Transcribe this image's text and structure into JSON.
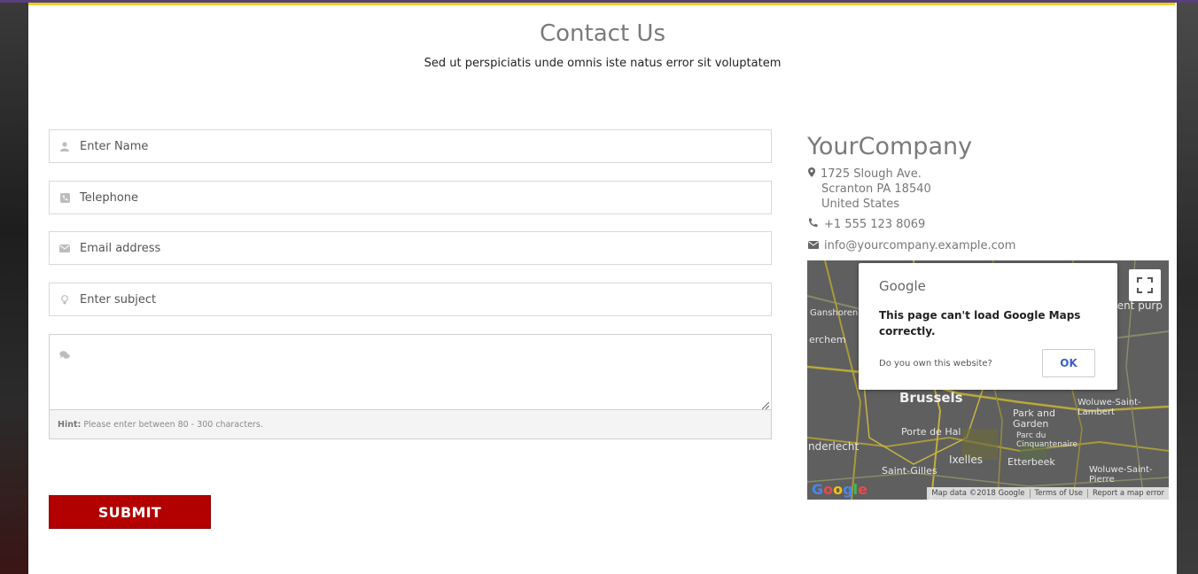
{
  "header": {
    "title": "Contact Us",
    "subtitle": "Sed ut perspiciatis unde omnis iste natus error sit voluptatem"
  },
  "form": {
    "name_placeholder": "Enter Name",
    "telephone_placeholder": "Telephone",
    "email_placeholder": "Email address",
    "subject_placeholder": "Enter subject",
    "message_placeholder": "",
    "hint_label": "Hint:",
    "hint_text": "Please enter between 80 - 300 characters.",
    "submit_label": "SUBMIT"
  },
  "company": {
    "name": "YourCompany",
    "address_line1": "1725 Slough Ave.",
    "address_line2": "Scranton PA 18540",
    "address_line3": "United States",
    "phone": "+1 555 123 8069",
    "email": "info@yourcompany.example.com"
  },
  "map": {
    "dialog_logo": "Google",
    "error_message": "This page can't load Google Maps correctly.",
    "own_question": "Do you own this website?",
    "ok_label": "OK",
    "corner_logo": "Google",
    "footer": [
      "Map data ©2018 Google",
      "Terms of Use",
      "Report a map error"
    ],
    "labels": {
      "brussels": "Brussels",
      "anderlecht": "nderlecht",
      "ixelles": "Ixelles",
      "etterbeek": "Etterbeek",
      "saint_gilles": "Saint-Gilles",
      "porte_de_hal": "Porte de Hal",
      "park_and_garden": "Park and Garden",
      "parc_du_cinquantenaire": "Parc du Cinquantenaire",
      "woluwe_lambert": "Woluwe-Saint-Lambert",
      "woluwe_pierre": "Woluwe-Saint-Pierre",
      "ganshoren": "Ganshoren",
      "berchem": "erchem",
      "ment_purp": "ment purp"
    }
  },
  "colors": {
    "submit_bg": "#b30000",
    "accent_top": "#e8d21a",
    "ok_text": "#3b5ec8"
  }
}
